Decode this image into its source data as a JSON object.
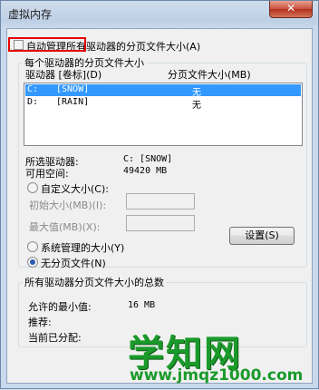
{
  "window": {
    "title": "虚拟内存",
    "close_glyph": "✕"
  },
  "auto_manage": {
    "label": "自动管理所有驱动器的分页文件大小(A)",
    "checked": false
  },
  "per_drive": {
    "legend": "每个驱动器的分页文件大小",
    "col_drive": "驱动器 [卷标](D)",
    "col_size": "分页文件大小(MB)",
    "drives": [
      {
        "name": "C:",
        "label": "[SNOW]",
        "size": "无",
        "selected": true
      },
      {
        "name": "D:",
        "label": "[RAIN]",
        "size": "无",
        "selected": false
      }
    ],
    "selected_drive_label": "所选驱动器:",
    "selected_drive_value": "C:  [SNOW]",
    "free_space_label": "可用空间:",
    "free_space_value": "49420 MB",
    "custom_size_label": "自定义大小(C):",
    "initial_size_label": "初始大小(MB)(I):",
    "initial_size_value": "",
    "max_size_label": "最大值(MB)(X):",
    "max_size_value": "",
    "system_managed_label": "系统管理的大小(Y)",
    "no_paging_label": "无分页文件(N)",
    "selected_option": "no_paging",
    "set_button": "设置(S)"
  },
  "totals": {
    "legend": "所有驱动器分页文件大小的总数",
    "min_allowed_label": "允许的最小值:",
    "min_allowed_value": "16 MB",
    "recommended_label": "推荐:",
    "currently_allocated_label": "当前已分配:"
  },
  "watermark": {
    "title": "学知网",
    "url": "www.jmqz1000.com"
  },
  "colors": {
    "selection": "#3399ff",
    "highlight_box": "#e60000",
    "watermark": "#1a9a2a"
  }
}
